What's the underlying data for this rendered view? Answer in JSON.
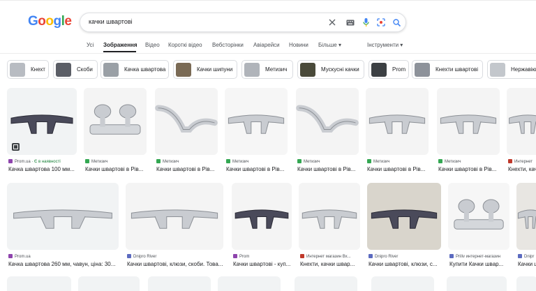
{
  "header": {
    "logo": [
      {
        "ch": "G",
        "color": "#4285f4"
      },
      {
        "ch": "o",
        "color": "#ea4335"
      },
      {
        "ch": "o",
        "color": "#fbbc05"
      },
      {
        "ch": "g",
        "color": "#4285f4"
      },
      {
        "ch": "l",
        "color": "#34a853"
      },
      {
        "ch": "e",
        "color": "#ea4335"
      }
    ],
    "query": "качки швартові"
  },
  "tabs": [
    {
      "label": "Усі",
      "active": false
    },
    {
      "label": "Зображення",
      "active": true
    },
    {
      "label": "Відео",
      "active": false
    },
    {
      "label": "Короткі відео",
      "active": false
    },
    {
      "label": "Вебсторінки",
      "active": false
    },
    {
      "label": "Авіарейси",
      "active": false
    },
    {
      "label": "Новини",
      "active": false
    },
    {
      "label": "Більше ▾",
      "active": false
    },
    {
      "label": "Інструменти ▾",
      "active": false
    }
  ],
  "chips": [
    "Кнехт",
    "Скоби",
    "Качка швартова",
    "Качки шипуни",
    "Метизич",
    "Мускусні качки",
    "Prom",
    "Кнехти швартові",
    "Нержавіючі"
  ],
  "row1": [
    {
      "source": "Prom.ua",
      "extra": " · Є в наявності",
      "title": "Качка швартова 100 мм...",
      "color": "#8e44ad"
    },
    {
      "source": "Метизич",
      "extra": "",
      "title": "Качки швартові в Рів...",
      "color": "#34a853"
    },
    {
      "source": "Метизич",
      "extra": "",
      "title": "Качки швартові в Рів...",
      "color": "#34a853"
    },
    {
      "source": "Метизич",
      "extra": "",
      "title": "Качки швартові в Рів...",
      "color": "#34a853"
    },
    {
      "source": "Метизич",
      "extra": "",
      "title": "Качки швартові в Рів...",
      "color": "#34a853"
    },
    {
      "source": "Метизич",
      "extra": "",
      "title": "Качки швартові в Рів...",
      "color": "#34a853"
    },
    {
      "source": "Метизич",
      "extra": "",
      "title": "Качки швартові в Рів...",
      "color": "#34a853"
    },
    {
      "source": "Интернет",
      "extra": "",
      "title": "Кнехти, качк",
      "color": "#c0392b"
    }
  ],
  "row2": [
    {
      "source": "Prom.ua",
      "extra": "",
      "title": "Качка швартова 260 мм, чавун, ціна: 30...",
      "color": "#8e44ad"
    },
    {
      "source": "Dnipro River",
      "extra": "",
      "title": "Качки швартові, клюзи, скоби. Това...",
      "color": "#5c6bc0"
    },
    {
      "source": "Prom",
      "extra": "",
      "title": "Качки швартові - куп...",
      "color": "#8e44ad"
    },
    {
      "source": "Интернет магазин Вх...",
      "extra": "",
      "title": "Кнехти, качки швар...",
      "color": "#c0392b"
    },
    {
      "source": "Dnipro River",
      "extra": "",
      "title": "Качки швартові, клюзи, с...",
      "color": "#5c6bc0"
    },
    {
      "source": "Priliv интернет-магазин",
      "extra": "",
      "title": "Купити Качки швар...",
      "color": "#5c6bc0"
    },
    {
      "source": "Dnipr",
      "extra": "",
      "title": "Качки ш",
      "color": "#5c6bc0"
    }
  ]
}
